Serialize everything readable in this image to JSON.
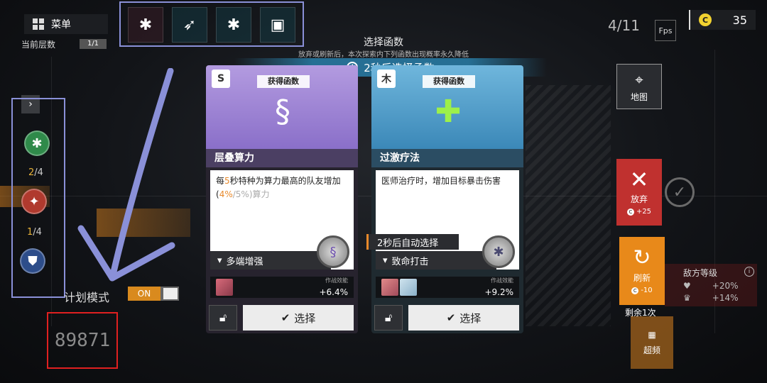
{
  "menu": {
    "label": "菜单",
    "icon": "grid-icon"
  },
  "floor": {
    "label": "当前层数",
    "value": "1/1"
  },
  "top_icons": [
    "heart-gear-icon",
    "bow-icon",
    "gear-icon",
    "shield-card-icon"
  ],
  "page_count": "4/11",
  "fps_label": "Fps",
  "coins": {
    "icon": "C",
    "amount": "35"
  },
  "header": {
    "title": "选择函数",
    "subtitle": "放弃或刷新后，本次探索内下列函数出现概率永久降低",
    "timer": "2秒后选择函数"
  },
  "side": {
    "nodes": [
      {
        "icon": "green-gear-icon",
        "count_a": "2",
        "count_b": "/4"
      },
      {
        "icon": "red-satellite-icon",
        "count_a": "1",
        "count_b": "/4"
      },
      {
        "icon": "blue-shield-icon"
      }
    ],
    "plan_label": "计划模式",
    "toggle": "ON",
    "score": "89871"
  },
  "cards": [
    {
      "badge": "S",
      "get_label": "获得函数",
      "name": "层叠算力",
      "desc_a": "每",
      "desc_b": "5",
      "desc_c": "秒特种为算力最高的队友增加(",
      "desc_d": "4%",
      "desc_e": "/5%)算力",
      "sub_tag": "多端增强",
      "eff_label": "作战效能",
      "eff_value": "+6.4%",
      "select": "选择"
    },
    {
      "badge": "木",
      "get_label": "获得函数",
      "name": "过激疗法",
      "desc": "医师治疗时，增加目标暴击伤害",
      "sub_tag": "致命打击",
      "eff_label": "作战效能",
      "eff_value": "+9.2%",
      "select": "选择"
    }
  ],
  "auto_select": "2秒后自动选择",
  "right": {
    "map": "地图",
    "abandon": {
      "label": "放弃",
      "cost": "+25"
    },
    "refresh": {
      "label": "刷新",
      "cost": "-10"
    },
    "remain": "剩余1次",
    "overclock": "超频",
    "enemy": {
      "title": "敌方等级",
      "row1": "+20%",
      "row2": "+14%"
    }
  },
  "colors": {
    "accent_orange": "#e8891a",
    "abandon_red": "#c0312f",
    "card1_purple": "#8a6fc9",
    "card2_blue": "#3b88b8",
    "highlight_box": "#8a90d8",
    "score_box": "#e02020"
  }
}
